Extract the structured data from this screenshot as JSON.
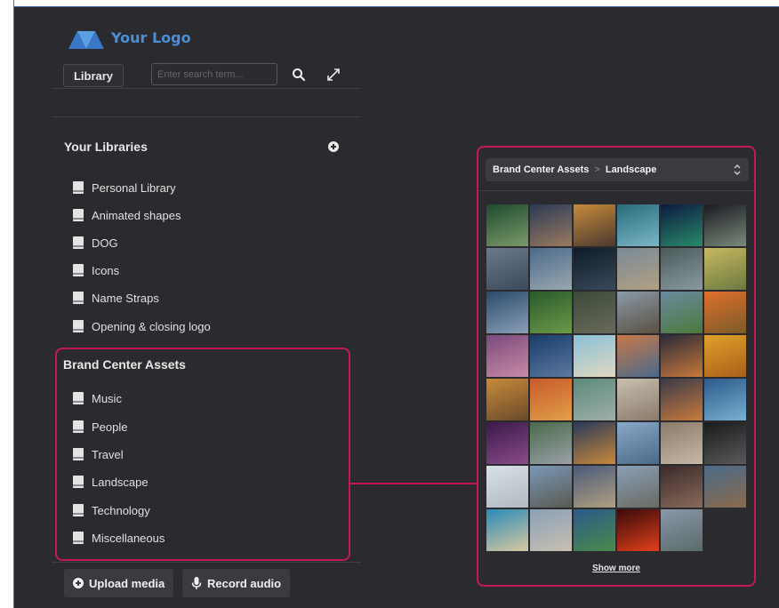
{
  "app": {
    "logo_text": "Your Logo"
  },
  "toolbar": {
    "library_label": "Library",
    "search_placeholder": "Enter search term..."
  },
  "your_libraries": {
    "title": "Your Libraries",
    "items": [
      {
        "label": "Personal Library"
      },
      {
        "label": "Animated shapes"
      },
      {
        "label": "DOG"
      },
      {
        "label": "Icons"
      },
      {
        "label": "Name Straps"
      },
      {
        "label": "Opening & closing logo"
      }
    ]
  },
  "brand_center": {
    "title": "Brand Center Assets",
    "items": [
      {
        "label": "Music"
      },
      {
        "label": "People"
      },
      {
        "label": "Travel"
      },
      {
        "label": "Landscape"
      },
      {
        "label": "Technology"
      },
      {
        "label": "Miscellaneous"
      }
    ]
  },
  "bottom": {
    "upload_label": "Upload media",
    "record_label": "Record audio"
  },
  "panel": {
    "breadcrumb": [
      "Brand Center Assets",
      "Landscape"
    ],
    "breadcrumb_sep": ">",
    "show_more": "Show more",
    "thumbnails": [
      {
        "name": "thumb-mountain-green",
        "c1": "#1f4a2e",
        "c2": "#7a9a6a"
      },
      {
        "name": "thumb-city-dusk",
        "c1": "#2b3a55",
        "c2": "#9a7a60"
      },
      {
        "name": "thumb-city-golden",
        "c1": "#c68a3a",
        "c2": "#4a3a30"
      },
      {
        "name": "thumb-wave",
        "c1": "#2a6a7a",
        "c2": "#7ab8c8"
      },
      {
        "name": "thumb-aurora",
        "c1": "#0c1a40",
        "c2": "#2a8a6a"
      },
      {
        "name": "thumb-skyline-night",
        "c1": "#1a1a22",
        "c2": "#7a8a7a"
      },
      {
        "name": "thumb-city-aerial",
        "c1": "#6a7a8a",
        "c2": "#3a4a5a"
      },
      {
        "name": "thumb-harbour",
        "c1": "#4a6a8a",
        "c2": "#9aa8b0"
      },
      {
        "name": "thumb-city-dark",
        "c1": "#0e1a2a",
        "c2": "#3a4a5a"
      },
      {
        "name": "thumb-town",
        "c1": "#7a8a9a",
        "c2": "#b0a080"
      },
      {
        "name": "thumb-hills",
        "c1": "#4a5a5a",
        "c2": "#8a9aa0"
      },
      {
        "name": "thumb-field-lines",
        "c1": "#c8b860",
        "c2": "#6a7a40"
      },
      {
        "name": "thumb-skyscrapers",
        "c1": "#2a4a6a",
        "c2": "#8aa0b8"
      },
      {
        "name": "thumb-forest-green",
        "c1": "#2a5a2a",
        "c2": "#6a9a4a"
      },
      {
        "name": "thumb-roundabout",
        "c1": "#3a4a3a",
        "c2": "#6a6a5a"
      },
      {
        "name": "thumb-desert-road",
        "c1": "#8a9aa8",
        "c2": "#5a5040"
      },
      {
        "name": "thumb-meadow",
        "c1": "#6a8aa0",
        "c2": "#4a7a3a"
      },
      {
        "name": "thumb-sunset-field",
        "c1": "#e0702a",
        "c2": "#7a5a2a"
      },
      {
        "name": "thumb-lavender",
        "c1": "#7a4a7a",
        "c2": "#c88aa8"
      },
      {
        "name": "thumb-bridge",
        "c1": "#1a3a6a",
        "c2": "#5a7aa0"
      },
      {
        "name": "thumb-palm-beach",
        "c1": "#8ac0d8",
        "c2": "#e0d8c0"
      },
      {
        "name": "thumb-river-city",
        "c1": "#c8784a",
        "c2": "#4a6a8a"
      },
      {
        "name": "thumb-sunset-city",
        "c1": "#2a2a3a",
        "c2": "#c8783a"
      },
      {
        "name": "thumb-golden-sky",
        "c1": "#e0a02a",
        "c2": "#a8601a"
      },
      {
        "name": "thumb-dunes",
        "c1": "#c88a3a",
        "c2": "#6a4a2a"
      },
      {
        "name": "thumb-neon-street",
        "c1": "#c85a2a",
        "c2": "#e0a04a"
      },
      {
        "name": "thumb-rail-aerial",
        "c1": "#5a8a7a",
        "c2": "#a0b0a8"
      },
      {
        "name": "thumb-fog-road",
        "c1": "#c8c0b0",
        "c2": "#8a7a6a"
      },
      {
        "name": "thumb-dusk-horizon",
        "c1": "#3a3a4a",
        "c2": "#c87a3a"
      },
      {
        "name": "thumb-city-lights",
        "c1": "#2a5a8a",
        "c2": "#7ab0d0"
      },
      {
        "name": "thumb-purple-night",
        "c1": "#3a1a4a",
        "c2": "#8a4a8a"
      },
      {
        "name": "thumb-tower-city",
        "c1": "#4a6a4a",
        "c2": "#9aa0a8"
      },
      {
        "name": "thumb-coast-sunset",
        "c1": "#2a3a5a",
        "c2": "#c8883a"
      },
      {
        "name": "thumb-snow-peaks",
        "c1": "#8aa8c8",
        "c2": "#4a6a8a"
      },
      {
        "name": "thumb-rock",
        "c1": "#8a7a6a",
        "c2": "#c8b8a8"
      },
      {
        "name": "thumb-black-sand",
        "c1": "#1a1a1a",
        "c2": "#5a5a5a"
      },
      {
        "name": "thumb-balloons",
        "c1": "#d8e0e8",
        "c2": "#b0b8c0"
      },
      {
        "name": "thumb-city-sprawl",
        "c1": "#7a98b8",
        "c2": "#5a5a50"
      },
      {
        "name": "thumb-skyline-day",
        "c1": "#4a5a7a",
        "c2": "#b0a080"
      },
      {
        "name": "thumb-plain",
        "c1": "#8aa0b8",
        "c2": "#6a6a60"
      },
      {
        "name": "thumb-night-towers",
        "c1": "#3a2a2a",
        "c2": "#8a6a5a"
      },
      {
        "name": "thumb-ferris",
        "c1": "#4a6a8a",
        "c2": "#8a6a4a"
      },
      {
        "name": "thumb-turquoise-coast",
        "c1": "#2a8ab8",
        "c2": "#d8c8a0"
      },
      {
        "name": "thumb-mosque",
        "c1": "#8aa0b8",
        "c2": "#c8c0b0"
      },
      {
        "name": "thumb-bluegreen",
        "c1": "#2a5a8a",
        "c2": "#4a8a4a"
      },
      {
        "name": "thumb-red-sun",
        "c1": "#3a0a0a",
        "c2": "#e0401a"
      },
      {
        "name": "thumb-grey-city",
        "c1": "#8a98a8",
        "c2": "#5a6a6a"
      }
    ]
  }
}
